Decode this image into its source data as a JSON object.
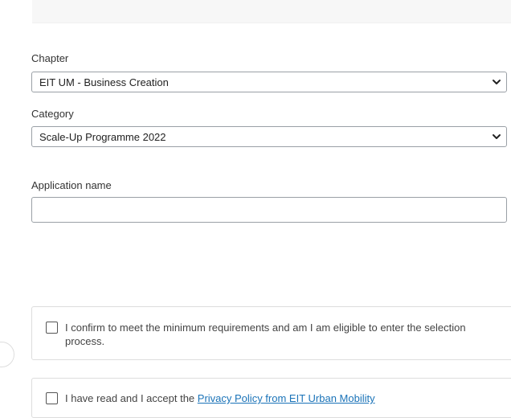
{
  "form": {
    "chapter": {
      "label": "Chapter",
      "selected": "EIT UM - Business Creation"
    },
    "category": {
      "label": "Category",
      "selected": "Scale-Up Programme 2022"
    },
    "application_name": {
      "label": "Application name",
      "value": ""
    }
  },
  "consents": {
    "requirements": {
      "text": "I confirm to meet the minimum requirements and am I am eligible to enter the selection process.",
      "checked": false
    },
    "privacy": {
      "prefix": "I have read and I accept the ",
      "link_text": "Privacy Policy from EIT Urban Mobility",
      "checked": false
    }
  },
  "icons": {
    "select_arrow": "chevron-down-icon",
    "checkbox": "checkbox-unchecked"
  },
  "colors": {
    "link": "#1a73b8",
    "border": "#9aa0a6",
    "text": "#333333"
  }
}
